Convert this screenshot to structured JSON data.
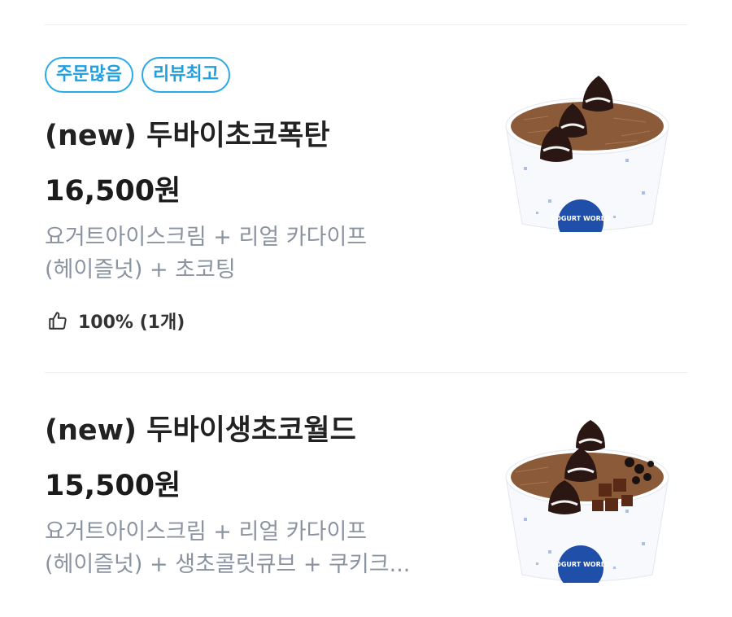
{
  "menu": {
    "items": [
      {
        "badges": [
          "주문많음",
          "리뷰최고"
        ],
        "title": " (new) 두바이초코폭탄",
        "price": "16,500원",
        "description_lines": [
          "요거트아이스크림 + 리얼 카다이프",
          "(헤이즐넛) + 초코팅"
        ],
        "rating": "100% (1개)",
        "cup_label": "YOGURT WORLD"
      },
      {
        "title": "(new) 두바이생초코월드",
        "price": "15,500원",
        "description_lines": [
          "요거트아이스크림 + 리얼 카다이프",
          "(헤이즐넛) + 생초콜릿큐브 + 쿠키크..."
        ],
        "cup_label": "YOGURT WORLD"
      }
    ]
  },
  "colors": {
    "badge": "#2aa8e8",
    "description": "#8a94a0",
    "divider": "#ebedf0",
    "cup_logo": "#1f4fa8"
  },
  "icons": {
    "rating": "thumbs-up-icon"
  }
}
